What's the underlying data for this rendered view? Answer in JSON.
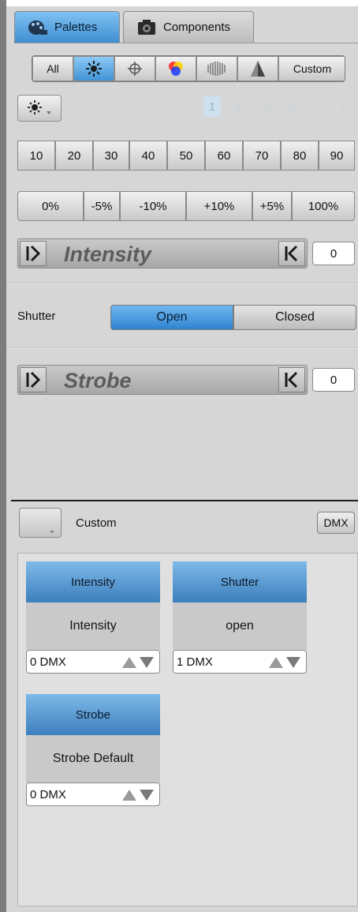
{
  "tabs": {
    "palettes": "Palettes",
    "components": "Components"
  },
  "filters": {
    "all": "All",
    "custom": "Custom"
  },
  "pages": [
    "1",
    "2",
    "3",
    "4",
    "5",
    "6"
  ],
  "levels": [
    "10",
    "20",
    "30",
    "40",
    "50",
    "60",
    "70",
    "80",
    "90"
  ],
  "steps": [
    "0%",
    "-5%",
    "-10%",
    "+10%",
    "+5%",
    "100%"
  ],
  "intensity": {
    "title": "Intensity",
    "value": "0"
  },
  "shutter": {
    "label": "Shutter",
    "open": "Open",
    "closed": "Closed"
  },
  "strobe": {
    "title": "Strobe",
    "value": "0"
  },
  "custom_row": {
    "label": "Custom",
    "dmx": "DMX"
  },
  "components": [
    {
      "header": "Intensity",
      "name": "Intensity",
      "dmx": "0 DMX"
    },
    {
      "header": "Shutter",
      "name": "open",
      "dmx": "1 DMX"
    },
    {
      "header": "Strobe",
      "name": "Strobe Default",
      "dmx": "0 DMX"
    }
  ],
  "colors": {
    "accent": "#3f93d6",
    "panel": "#d6d6d6"
  }
}
